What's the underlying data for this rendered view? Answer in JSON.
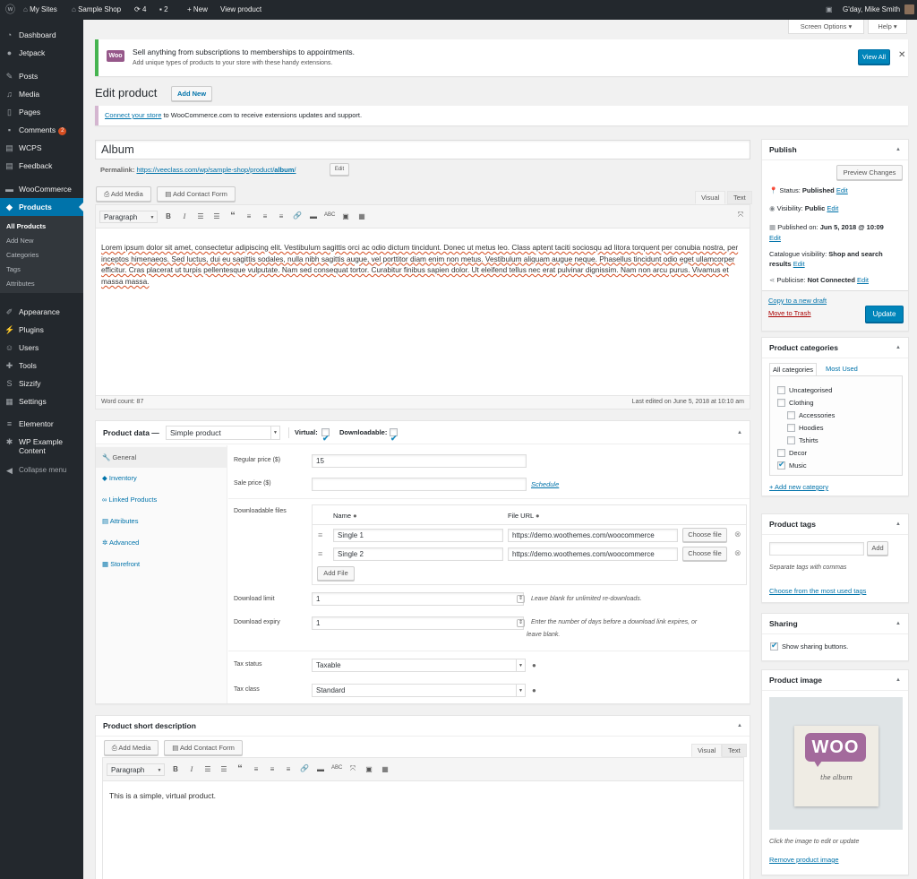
{
  "adminbar": {
    "sites": "My Sites",
    "shop": "Sample Shop",
    "updates": "4",
    "comments": "2",
    "new": "New",
    "view": "View product",
    "greeting": "G'day, Mike Smith"
  },
  "menu": {
    "dashboard": "Dashboard",
    "jetpack": "Jetpack",
    "posts": "Posts",
    "media": "Media",
    "pages": "Pages",
    "comments": "Comments",
    "comments_count": "2",
    "wcps": "WCPS",
    "feedback": "Feedback",
    "woocommerce": "WooCommerce",
    "products": "Products",
    "sub": [
      "All Products",
      "Add New",
      "Categories",
      "Tags",
      "Attributes"
    ],
    "appearance": "Appearance",
    "plugins": "Plugins",
    "users": "Users",
    "tools": "Tools",
    "sizzify": "Sizzify",
    "settings": "Settings",
    "elementor": "Elementor",
    "wpexample": "WP Example Content",
    "collapse": "Collapse menu"
  },
  "screen": {
    "options": "Screen Options ▾",
    "help": "Help ▾"
  },
  "notice": {
    "logo": "Woo",
    "title": "Sell anything from subscriptions to memberships to appointments.",
    "text": "Add unique types of products to your store with these handy extensions.",
    "view_all": "View All"
  },
  "page": {
    "title": "Edit product",
    "add_new": "Add New"
  },
  "connect": {
    "link": "Connect your store",
    "text": " to WooCommerce.com to receive extensions updates and support."
  },
  "product": {
    "title": "Album",
    "permalink_label": "Permalink:",
    "permalink_base": "https://veeclass.com/wp/sample-shop/product/",
    "permalink_slug": "album",
    "permalink_end": "/",
    "edit": "Edit"
  },
  "editor": {
    "add_media": "Add Media",
    "add_contact": "Add Contact Form",
    "visual": "Visual",
    "text": "Text",
    "paragraph": "Paragraph",
    "content": "Lorem ipsum dolor sit amet, consectetur adipiscing elit. Vestibulum sagittis orci ac odio dictum tincidunt. Donec ut metus leo. Class aptent taciti sociosqu ad litora torquent per conubia nostra, per inceptos himenaeos. Sed luctus, dui eu sagittis sodales, nulla nibh sagittis augue, vel porttitor diam enim non metus. Vestibulum aliquam augue neque. Phasellus tincidunt odio eget ullamcorper efficitur. Cras placerat ut turpis pellentesque vulputate. Nam sed consequat tortor. Curabitur finibus sapien dolor. Ut eleifend tellus nec erat pulvinar dignissim. Nam non arcu purus. Vivamus et massa massa.",
    "word_count": "Word count: 87",
    "last_edited": "Last edited on June 5, 2018 at 10:10 am"
  },
  "pdata": {
    "title": "Product data —",
    "type": "Simple product",
    "virtual": "Virtual:",
    "downloadable": "Downloadable:",
    "tabs": [
      "General",
      "Inventory",
      "Linked Products",
      "Attributes",
      "Advanced",
      "Storefront"
    ],
    "regular_label": "Regular price ($)",
    "regular": "15",
    "sale_label": "Sale price ($)",
    "schedule": "Schedule",
    "dl_label": "Downloadable files",
    "name_col": "Name",
    "url_col": "File URL",
    "files": [
      {
        "name": "Single 1",
        "url": "https://demo.woothemes.com/woocommerce"
      },
      {
        "name": "Single 2",
        "url": "https://demo.woothemes.com/woocommerce"
      }
    ],
    "choose": "Choose file",
    "add_file": "Add File",
    "limit_label": "Download limit",
    "limit": "1",
    "limit_hint": "Leave blank for unlimited re-downloads.",
    "expiry_label": "Download expiry",
    "expiry": "1",
    "expiry_hint1": "Enter the number of days before a download link expires, or",
    "expiry_hint2": "leave blank.",
    "tax_status_label": "Tax status",
    "tax_status": "Taxable",
    "tax_class_label": "Tax class",
    "tax_class": "Standard"
  },
  "short": {
    "title": "Product short description",
    "content": "This is a simple, virtual product."
  },
  "publish": {
    "title": "Publish",
    "preview": "Preview Changes",
    "status_l": "Status:",
    "status": "Published",
    "vis_l": "Visibility:",
    "vis": "Public",
    "pub_l": "Published on:",
    "pub": "Jun 5, 2018 @ 10:09",
    "edit": "Edit",
    "cat_l": "Catalogue visibility:",
    "cat": "Shop and search results",
    "pz_l": "Publicise:",
    "pz": "Not Connected",
    "copy": "Copy to a new draft",
    "trash": "Move to Trash",
    "update": "Update"
  },
  "cats": {
    "title": "Product categories",
    "tab_all": "All categories",
    "tab_used": "Most Used",
    "items": [
      "Uncategorised",
      "Clothing",
      "Accessories",
      "Hoodies",
      "Tshirts",
      "Decor",
      "Music"
    ],
    "add": "+ Add new category"
  },
  "tags": {
    "title": "Product tags",
    "add": "Add",
    "hint": "Separate tags with commas",
    "choose": "Choose from the most used tags"
  },
  "sharing": {
    "title": "Sharing",
    "show": "Show sharing buttons."
  },
  "image": {
    "title": "Product image",
    "woo": "WOO",
    "sub": "the   album",
    "hint": "Click the image to edit or update",
    "remove": "Remove product image"
  }
}
